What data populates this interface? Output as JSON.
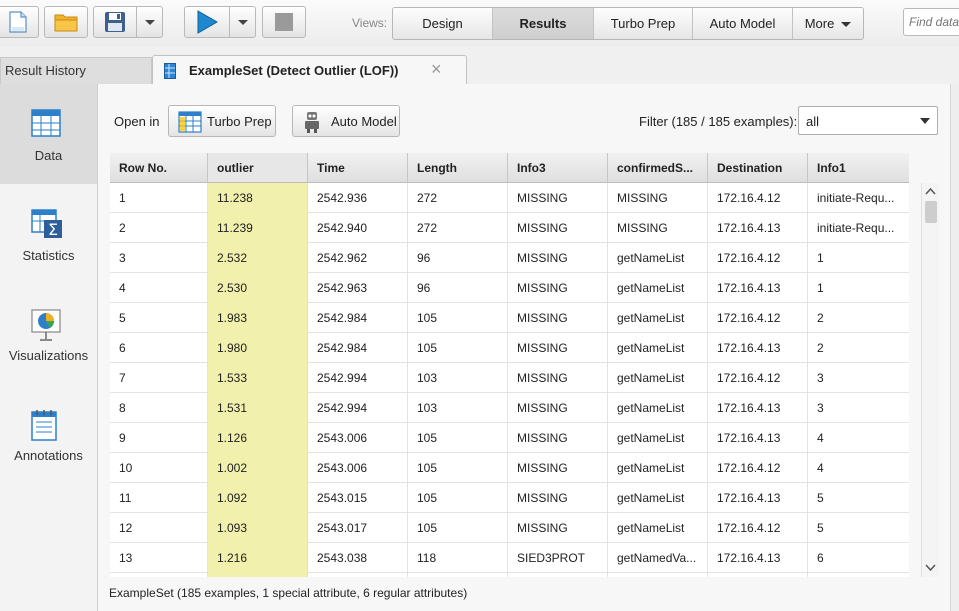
{
  "toolbar": {
    "views_label": "Views:",
    "views": [
      {
        "label": "Design",
        "active": false
      },
      {
        "label": "Results",
        "active": true
      },
      {
        "label": "Turbo Prep",
        "active": false
      },
      {
        "label": "Auto Model",
        "active": false
      },
      {
        "label": "More",
        "active": false
      }
    ],
    "find_placeholder": "Find data"
  },
  "tabs": {
    "history_label": "Result History",
    "active_label": "ExampleSet (Detect Outlier (LOF))",
    "close_glyph": "×"
  },
  "sidebar": {
    "items": [
      {
        "label": "Data",
        "icon": "table-icon",
        "active": true
      },
      {
        "label": "Statistics",
        "icon": "statistics-icon",
        "active": false
      },
      {
        "label": "Visualizations",
        "icon": "chart-icon",
        "active": false
      },
      {
        "label": "Annotations",
        "icon": "notepad-icon",
        "active": false
      }
    ]
  },
  "panel": {
    "open_in_label": "Open in",
    "turbo_prep_label": "Turbo Prep",
    "auto_model_label": "Auto Model",
    "filter_label": "Filter (185 / 185 examples):",
    "filter_value": "all"
  },
  "table": {
    "columns": [
      "Row No.",
      "outlier",
      "Time",
      "Length",
      "Info3",
      "confirmedS...",
      "Destination",
      "Info1"
    ],
    "rows": [
      [
        "1",
        "11.238",
        "2542.936",
        "272",
        "MISSING",
        "MISSING",
        "172.16.4.12",
        "initiate-Requ..."
      ],
      [
        "2",
        "11.239",
        "2542.940",
        "272",
        "MISSING",
        "MISSING",
        "172.16.4.13",
        "initiate-Requ..."
      ],
      [
        "3",
        "2.532",
        "2542.962",
        "96",
        "MISSING",
        "getNameList",
        "172.16.4.12",
        "1"
      ],
      [
        "4",
        "2.530",
        "2542.963",
        "96",
        "MISSING",
        "getNameList",
        "172.16.4.13",
        "1"
      ],
      [
        "5",
        "1.983",
        "2542.984",
        "105",
        "MISSING",
        "getNameList",
        "172.16.4.12",
        "2"
      ],
      [
        "6",
        "1.980",
        "2542.984",
        "105",
        "MISSING",
        "getNameList",
        "172.16.4.13",
        "2"
      ],
      [
        "7",
        "1.533",
        "2542.994",
        "103",
        "MISSING",
        "getNameList",
        "172.16.4.12",
        "3"
      ],
      [
        "8",
        "1.531",
        "2542.994",
        "103",
        "MISSING",
        "getNameList",
        "172.16.4.13",
        "3"
      ],
      [
        "9",
        "1.126",
        "2543.006",
        "105",
        "MISSING",
        "getNameList",
        "172.16.4.13",
        "4"
      ],
      [
        "10",
        "1.002",
        "2543.006",
        "105",
        "MISSING",
        "getNameList",
        "172.16.4.12",
        "4"
      ],
      [
        "11",
        "1.092",
        "2543.015",
        "105",
        "MISSING",
        "getNameList",
        "172.16.4.13",
        "5"
      ],
      [
        "12",
        "1.093",
        "2543.017",
        "105",
        "MISSING",
        "getNameList",
        "172.16.4.12",
        "5"
      ],
      [
        "13",
        "1.216",
        "2543.038",
        "118",
        "SIED3PROT",
        "getNamedVa...",
        "172.16.4.13",
        "6"
      ],
      [
        "",
        "",
        "",
        "",
        "",
        "",
        "",
        ""
      ]
    ]
  },
  "status_text": "ExampleSet (185 examples, 1 special attribute, 6 regular attributes)",
  "colors": {
    "highlight_column": "#f1f0ac",
    "play_blue": "#1e88d0"
  }
}
